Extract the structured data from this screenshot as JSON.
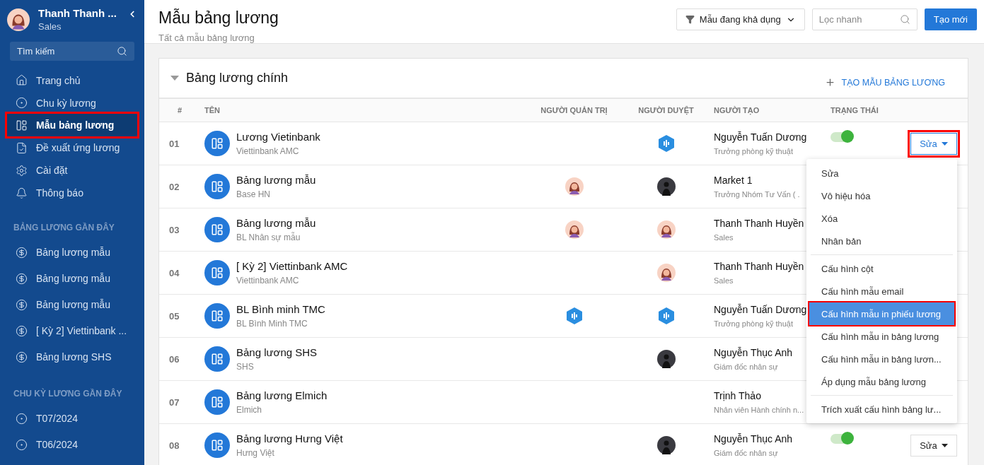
{
  "sidebar": {
    "user": {
      "name": "Thanh Thanh ...",
      "role": "Sales"
    },
    "search": {
      "placeholder": "Tìm kiếm"
    },
    "nav": [
      {
        "label": "Trang chủ",
        "selected": false,
        "annotated": false
      },
      {
        "label": "Chu kỳ lương",
        "selected": false,
        "annotated": false
      },
      {
        "label": "Mẫu bảng lương",
        "selected": true,
        "annotated": true
      },
      {
        "label": "Đề xuất ứng lương",
        "selected": false,
        "annotated": false
      },
      {
        "label": "Cài đặt",
        "selected": false,
        "annotated": false
      },
      {
        "label": "Thông báo",
        "selected": false,
        "annotated": false
      }
    ],
    "sections": [
      {
        "title": "BẢNG LƯƠNG GẦN ĐÂY",
        "kind": "payroll",
        "items": [
          "Bảng lương mẫu",
          "Bảng lương mẫu",
          "Bảng lương mẫu",
          "[ Kỳ 2] Viettinbank ...",
          "Bảng lương SHS"
        ]
      },
      {
        "title": "CHU KỲ LƯƠNG GẦN ĐÂY",
        "kind": "cycle",
        "items": [
          "T07/2024",
          "T06/2024"
        ]
      }
    ]
  },
  "header": {
    "title": "Mẫu bảng lương",
    "subtitle": "Tất cả mẫu bảng lương",
    "filter": "Mẫu đang khả dụng",
    "search": {
      "placeholder": "Lọc nhanh"
    },
    "create_button": "Tạo mới"
  },
  "card": {
    "title": "Bảng lương chính",
    "expanded": true,
    "add_link": "TẠO MẪU BẢNG LƯƠNG",
    "columns": [
      "#",
      "TÊN",
      "NGƯỜI QUẢN TRỊ",
      "NGƯỜI DUYỆT",
      "NGƯỜI TẠO",
      "TRẠNG THÁI"
    ],
    "rows": [
      {
        "index": "01",
        "name": "Lương Vietinbank",
        "group": "Viettinbank AMC",
        "approver": {
          "kind": "logo"
        },
        "creator": "Nguyễn Tuấn Dương",
        "creator_role": "Trưởng phòng kỹ thuật",
        "status": {
          "on": true
        },
        "action": {
          "label": "Sửa",
          "annotated": true
        }
      },
      {
        "index": "02",
        "name": "Bảng lương mẫu",
        "group": "Base HN",
        "admin": {
          "kind": "woman"
        },
        "approver": {
          "kind": "dark"
        },
        "creator": "Market 1",
        "creator_role": "Trưởng Nhóm Tư Vấn ( ."
      },
      {
        "index": "03",
        "name": "Bảng lương mẫu",
        "group": "BL Nhân sự mẫu",
        "admin": {
          "kind": "woman"
        },
        "approver": {
          "kind": "woman"
        },
        "creator": "Thanh Thanh Huyền",
        "creator_role": "Sales"
      },
      {
        "index": "04",
        "name": "[ Kỳ 2] Viettinbank AMC",
        "group": "Viettinbank AMC",
        "approver": {
          "kind": "woman"
        },
        "creator": "Thanh Thanh Huyền",
        "creator_role": "Sales"
      },
      {
        "index": "05",
        "name": "BL Bình minh TMC",
        "group": "BL Bình Minh TMC",
        "admin": {
          "kind": "logo"
        },
        "approver": {
          "kind": "logo"
        },
        "creator": "Nguyễn Tuấn Dương",
        "creator_role": "Trưởng phòng kỹ thuật"
      },
      {
        "index": "06",
        "name": "Bảng lương SHS",
        "group": "SHS",
        "approver": {
          "kind": "dark"
        },
        "creator": "Nguyễn Thục Anh",
        "creator_role": "Giám đốc nhân sự"
      },
      {
        "index": "07",
        "name": "Bảng lương Elmich",
        "group": "Elmich",
        "creator": "Trịnh Thảo",
        "creator_role": "Nhân viên Hành chính n..."
      },
      {
        "index": "08",
        "name": "Bảng lương Hưng Việt",
        "group": "Hưng Việt",
        "approver": {
          "kind": "dark"
        },
        "creator": "Nguyễn Thục Anh",
        "creator_role": "Giám đốc nhân sự",
        "status": {
          "on": true
        },
        "action": {
          "label": "Sửa",
          "annotated": false
        }
      }
    ]
  },
  "menu": {
    "groups": [
      [
        {
          "label": "Sửa",
          "selected": false,
          "annotated": false
        },
        {
          "label": "Vô hiệu hóa",
          "selected": false,
          "annotated": false
        },
        {
          "label": "Xóa",
          "selected": false,
          "annotated": false
        },
        {
          "label": "Nhân bản",
          "selected": false,
          "annotated": false
        }
      ],
      [
        {
          "label": "Cấu hình cột",
          "selected": false,
          "annotated": false
        },
        {
          "label": "Cấu hình mẫu email",
          "selected": false,
          "annotated": false
        },
        {
          "label": "Cấu hình mẫu in phiếu lương",
          "selected": true,
          "annotated": true
        },
        {
          "label": "Cấu hình mẫu in bảng lương",
          "selected": false,
          "annotated": false
        },
        {
          "label": "Cấu hình mẫu in bảng lươn...",
          "selected": false,
          "annotated": false
        },
        {
          "label": "Áp dụng mẫu bảng lương",
          "selected": false,
          "annotated": false
        }
      ],
      [
        {
          "label": "Trích xuất cấu hình bảng lư...",
          "selected": false,
          "annotated": false
        }
      ]
    ]
  }
}
